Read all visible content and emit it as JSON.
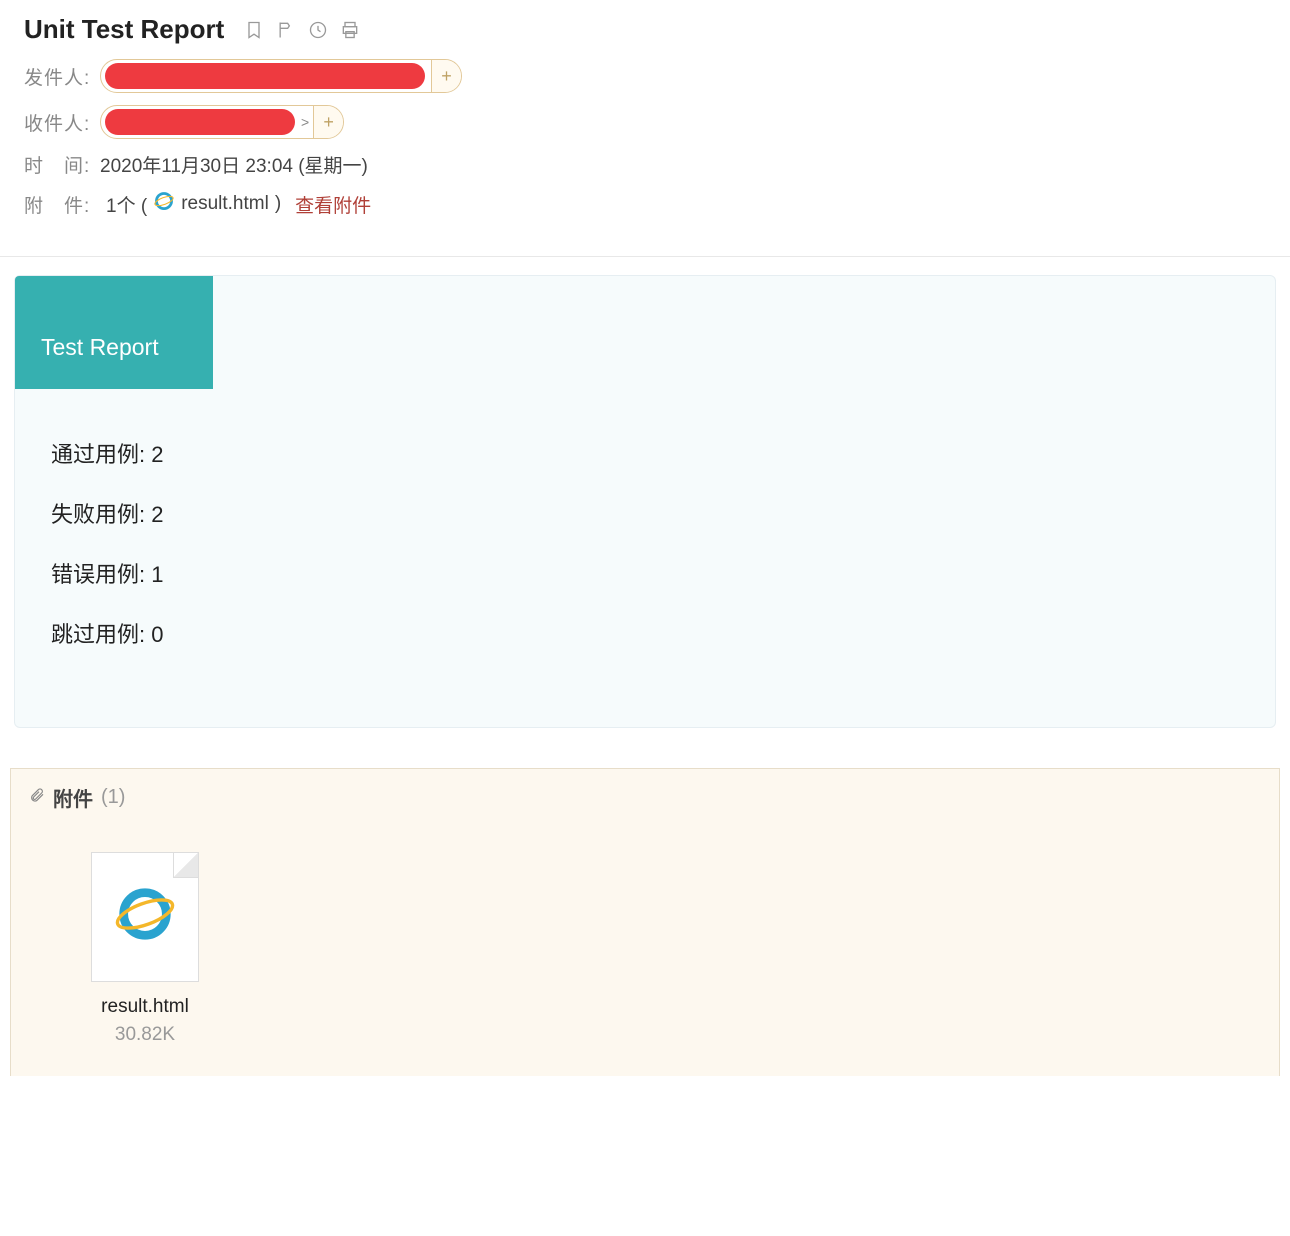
{
  "header": {
    "subject": "Unit Test Report",
    "from_label": "发件人:",
    "to_label": "收件人:",
    "time_label": "时　间:",
    "time_value": "2020年11月30日 23:04 (星期一)",
    "attach_label": "附　件:",
    "attach_count_text": "1个 (",
    "attach_file_name": "result.html",
    "attach_close_paren": ")",
    "view_attach": "查看附件"
  },
  "report": {
    "tab_title": "Test Report",
    "stats": {
      "passed_label": "通过用例:",
      "passed_value": "2",
      "failed_label": "失败用例:",
      "failed_value": "2",
      "error_label": "错误用例:",
      "error_value": "1",
      "skipped_label": "跳过用例:",
      "skipped_value": "0"
    }
  },
  "attachments": {
    "title": "附件",
    "count_text": "(1)",
    "file": {
      "name": "result.html",
      "size": "30.82K"
    }
  }
}
